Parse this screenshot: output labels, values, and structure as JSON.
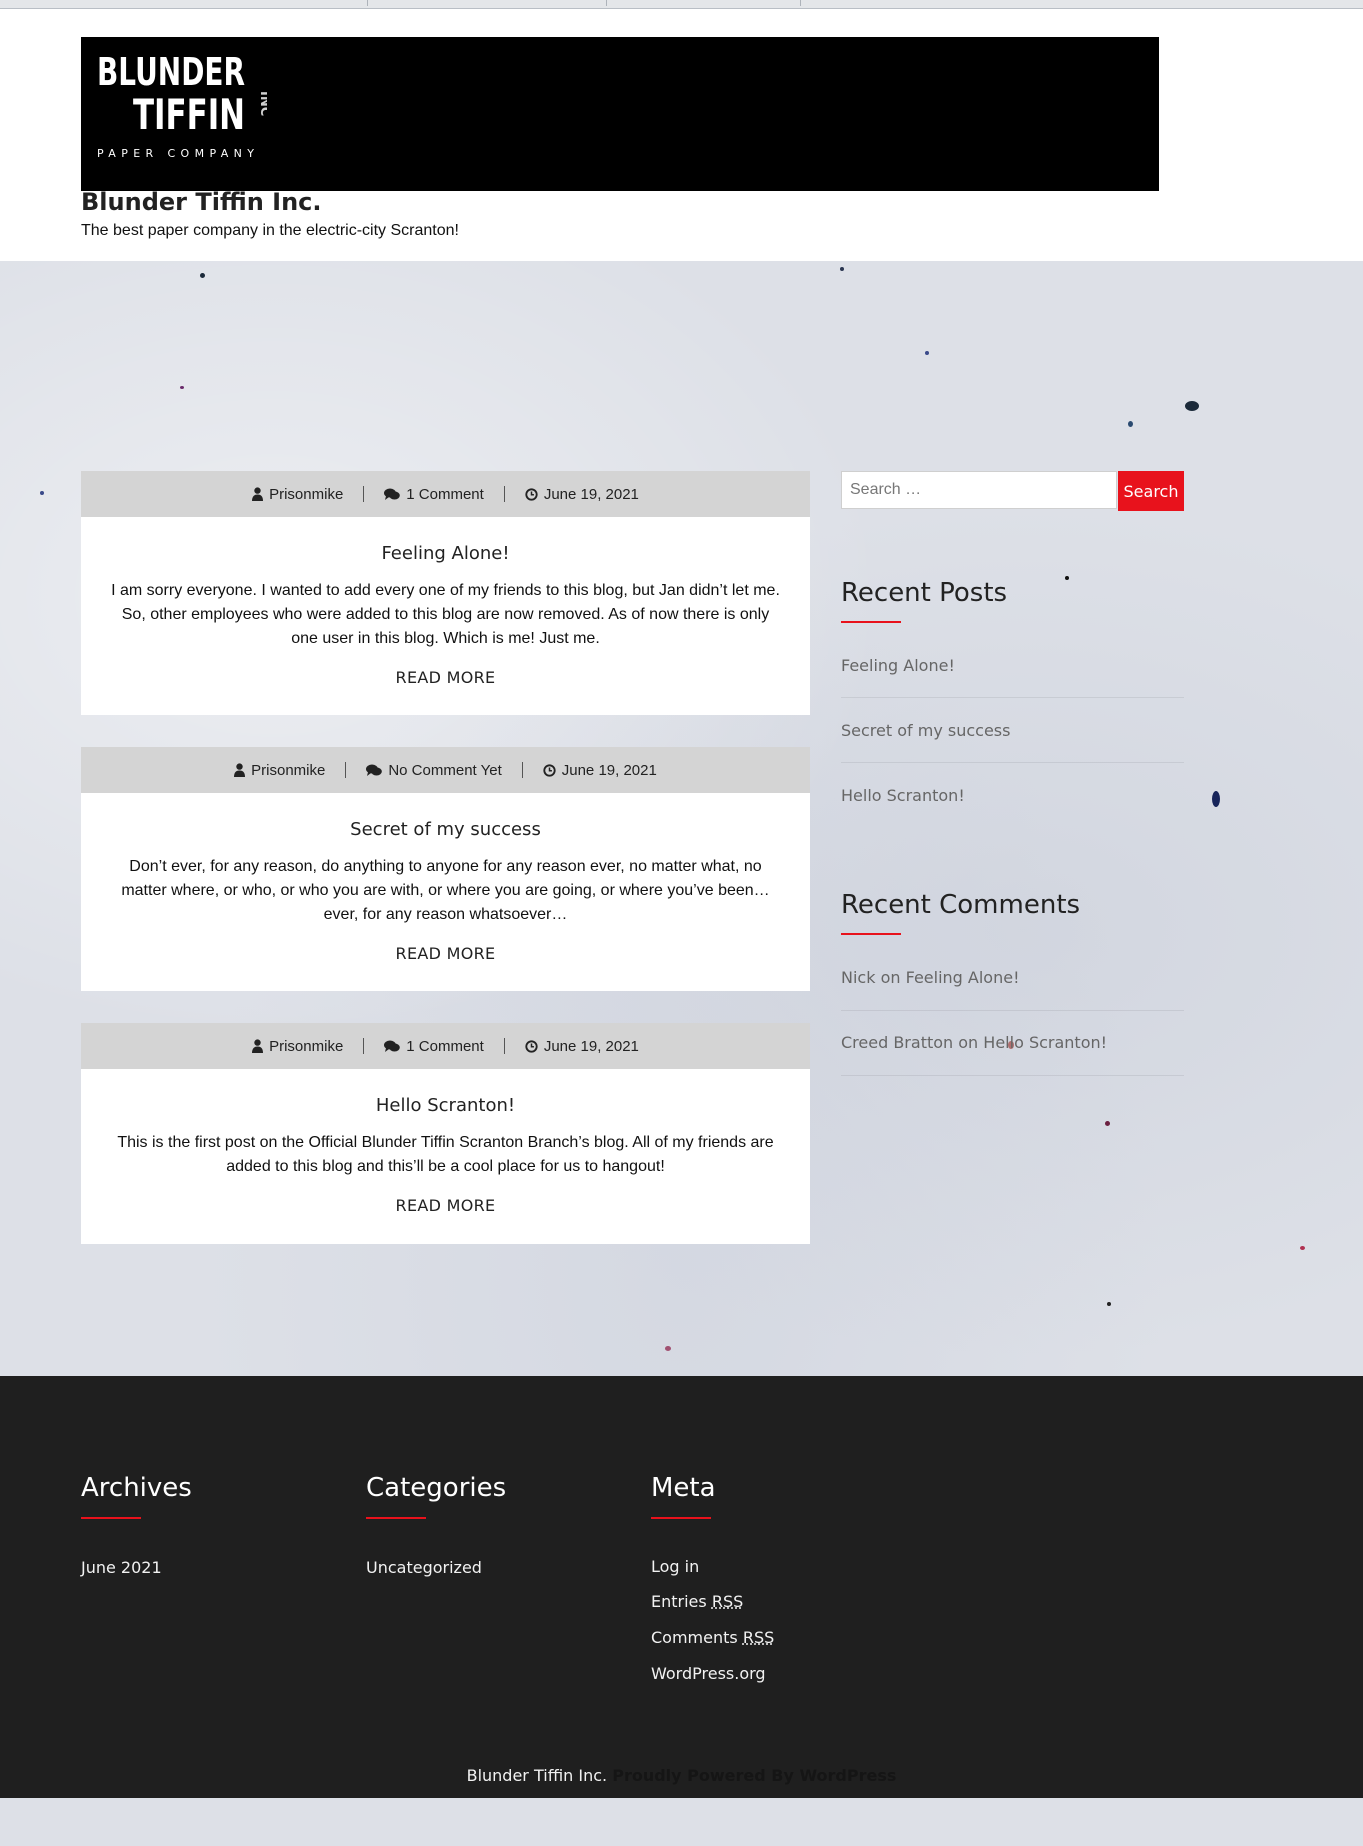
{
  "site": {
    "logo_text": [
      "BLUNDER",
      "TIFFIN",
      "INC",
      "PAPER COMPANY"
    ],
    "title": "Blunder Tiffin Inc.",
    "tagline": "The best paper company in the electric-city Scranton!"
  },
  "posts": [
    {
      "author": "Prisonmike",
      "comments": "1 Comment",
      "date": "June 19, 2021",
      "title": "Feeling Alone!",
      "excerpt": "I am sorry everyone. I wanted to add every one of my friends to this blog, but Jan didn’t let me. So, other employees who were added to this blog are now removed. As of now there is only one user in this blog. Which is me! Just me.",
      "read_more": "READ MORE"
    },
    {
      "author": "Prisonmike",
      "comments": "No Comment Yet",
      "date": "June 19, 2021",
      "title": "Secret of my success",
      "excerpt": "Don’t ever, for any reason, do anything to anyone for any reason ever, no matter what, no matter where, or who, or who you are with, or where you are going, or where you’ve been… ever, for any reason whatsoever…",
      "read_more": "READ MORE"
    },
    {
      "author": "Prisonmike",
      "comments": "1 Comment",
      "date": "June 19, 2021",
      "title": "Hello Scranton!",
      "excerpt": "This is the first post on the Official Blunder Tiffin Scranton Branch’s blog. All of my friends are added to this blog and this’ll be a cool place for us to hangout!",
      "read_more": "READ MORE"
    }
  ],
  "sidebar": {
    "search_placeholder": "Search …",
    "search_button": "Search",
    "recent_posts_title": "Recent Posts",
    "recent_posts": [
      "Feeling Alone!",
      "Secret of my success",
      "Hello Scranton!"
    ],
    "recent_comments_title": "Recent Comments",
    "recent_comments": [
      {
        "author": "Nick",
        "on": "on",
        "post": "Feeling Alone!"
      },
      {
        "author": "Creed Bratton",
        "on": "on",
        "post": "Hello Scranton!"
      }
    ]
  },
  "footer": {
    "archives_title": "Archives",
    "archives": [
      "June 2021"
    ],
    "categories_title": "Categories",
    "categories": [
      "Uncategorized"
    ],
    "meta_title": "Meta",
    "meta": {
      "login": "Log in",
      "entries": "Entries",
      "comments": "Comments",
      "rss": "RSS",
      "wordpress": "WordPress.org"
    },
    "credits_site": "Blunder Tiffin Inc.",
    "credits_powered": "Proudly Powered By WordPress"
  },
  "colors": {
    "accent": "#e8121c",
    "footer_bg": "#1f1f1f",
    "meta_bar": "#d4d4d4"
  },
  "icons": {
    "author": "user-icon",
    "comments": "comments-icon",
    "date": "clock-icon"
  }
}
